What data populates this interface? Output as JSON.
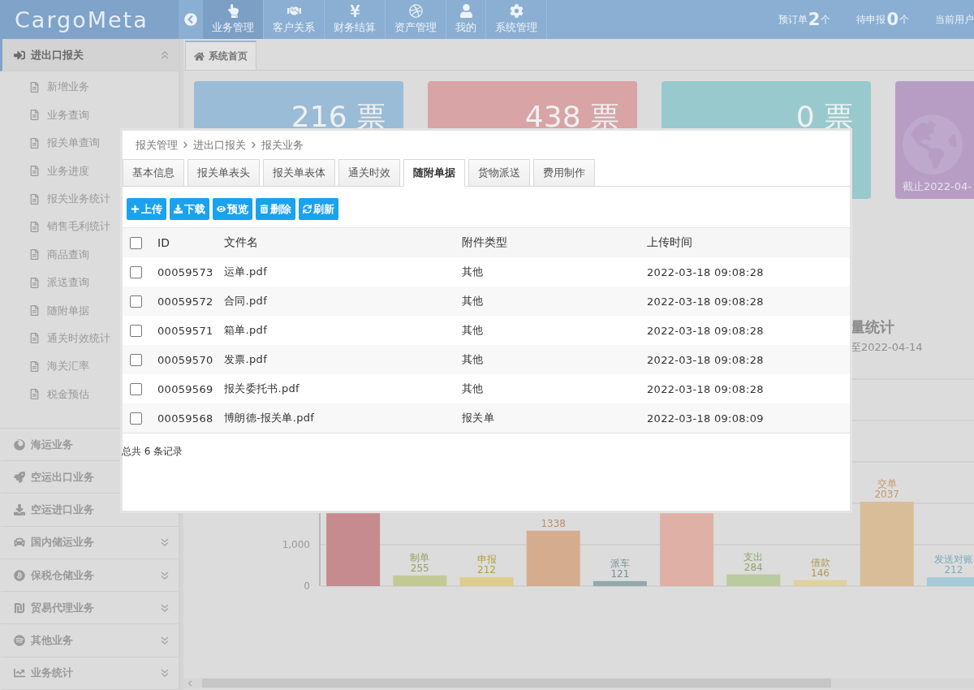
{
  "header": {
    "logo": "CargoMeta",
    "nav": [
      {
        "label": "业务管理",
        "selected": true
      },
      {
        "label": "客户关系",
        "selected": false
      },
      {
        "label": "财务结算",
        "selected": false
      },
      {
        "label": "资产管理",
        "selected": false
      },
      {
        "label": "我的",
        "selected": false
      },
      {
        "label": "系统管理",
        "selected": false
      }
    ],
    "stats": [
      {
        "label": "预订单",
        "count": "2",
        "unit": "个"
      },
      {
        "label": "待申报",
        "count": "0",
        "unit": "个"
      }
    ],
    "user_label": "当前用户"
  },
  "sidebar": {
    "sections": [
      {
        "title": "进出口报关",
        "expanded": true,
        "children": [
          {
            "label": "新增业务"
          },
          {
            "label": "业务查询"
          },
          {
            "label": "报关单查询"
          },
          {
            "label": "业务进度"
          },
          {
            "label": "报关业务统计"
          },
          {
            "label": "销售毛利统计"
          },
          {
            "label": "商品查询"
          },
          {
            "label": "派送查询"
          },
          {
            "label": "随附单据"
          },
          {
            "label": "通关时效统计"
          },
          {
            "label": "海关汇率"
          },
          {
            "label": "税金预估"
          }
        ]
      },
      {
        "title": "海运业务",
        "expanded": false
      },
      {
        "title": "空运出口业务",
        "expanded": false
      },
      {
        "title": "空运进口业务",
        "expanded": false
      },
      {
        "title": "国内储运业务",
        "expanded": false
      },
      {
        "title": "保税仓储业务",
        "expanded": false
      },
      {
        "title": "贸易代理业务",
        "expanded": false
      },
      {
        "title": "其他业务",
        "expanded": false
      },
      {
        "title": "业务统计",
        "expanded": false
      }
    ]
  },
  "page_tabs": [
    {
      "label": "系统首页",
      "selected": true
    }
  ],
  "cards": [
    {
      "value": "216 票"
    },
    {
      "value": "438 票"
    },
    {
      "value": "0 票"
    },
    {
      "caption": "截止2022-04-"
    }
  ],
  "stats_panel": {
    "title": "量统计",
    "subtitle": "至2022-04-14",
    "chart_data": {
      "type": "bar",
      "categories": [
        null,
        "制单",
        "申报",
        null,
        "派车",
        null,
        "支出",
        "借款",
        "交单",
        "发送对账"
      ],
      "series": [
        {
          "values": [
            1760,
            255,
            212,
            1338,
            121,
            1760,
            284,
            146,
            2037,
            212
          ]
        }
      ],
      "ylim": [
        0,
        5000
      ],
      "yticks": [
        0,
        {
          "value": 1000,
          "label": "1,000"
        }
      ],
      "value_labels": [
        null,
        "255",
        "212",
        "1338",
        "121",
        null,
        "284",
        "146",
        "2037",
        "212"
      ]
    }
  },
  "dialog": {
    "breadcrumb": [
      "报关管理",
      "进出口报关",
      "报关业务"
    ],
    "tabs": [
      {
        "label": "基本信息",
        "selected": false
      },
      {
        "label": "报关单表头",
        "selected": false
      },
      {
        "label": "报关单表体",
        "selected": false
      },
      {
        "label": "通关时效",
        "selected": false
      },
      {
        "label": "随附单据",
        "selected": true
      },
      {
        "label": "货物派送",
        "selected": false
      },
      {
        "label": "费用制作",
        "selected": false
      }
    ],
    "buttons": [
      {
        "label": "上传"
      },
      {
        "label": "下载"
      },
      {
        "label": "预览"
      },
      {
        "label": "删除"
      },
      {
        "label": "刷新"
      }
    ],
    "table": {
      "all_checked": false,
      "columns": [
        "ID",
        "文件名",
        "附件类型",
        "上传时间"
      ],
      "rows": [
        {
          "checked": false,
          "cells": [
            "00059573",
            "运单.pdf",
            "其他",
            "2022-03-18 09:08:28"
          ]
        },
        {
          "checked": false,
          "cells": [
            "00059572",
            "合同.pdf",
            "其他",
            "2022-03-18 09:08:28"
          ]
        },
        {
          "checked": false,
          "cells": [
            "00059571",
            "箱单.pdf",
            "其他",
            "2022-03-18 09:08:28"
          ]
        },
        {
          "checked": false,
          "cells": [
            "00059570",
            "发票.pdf",
            "其他",
            "2022-03-18 09:08:28"
          ]
        },
        {
          "checked": false,
          "cells": [
            "00059569",
            "报关委托书.pdf",
            "其他",
            "2022-03-18 09:08:28"
          ]
        },
        {
          "checked": false,
          "cells": [
            "00059568",
            "博朗德-报关单.pdf",
            "报关单",
            "2022-03-18 09:08:09"
          ]
        }
      ]
    },
    "footer": "总共 6 条记录"
  }
}
